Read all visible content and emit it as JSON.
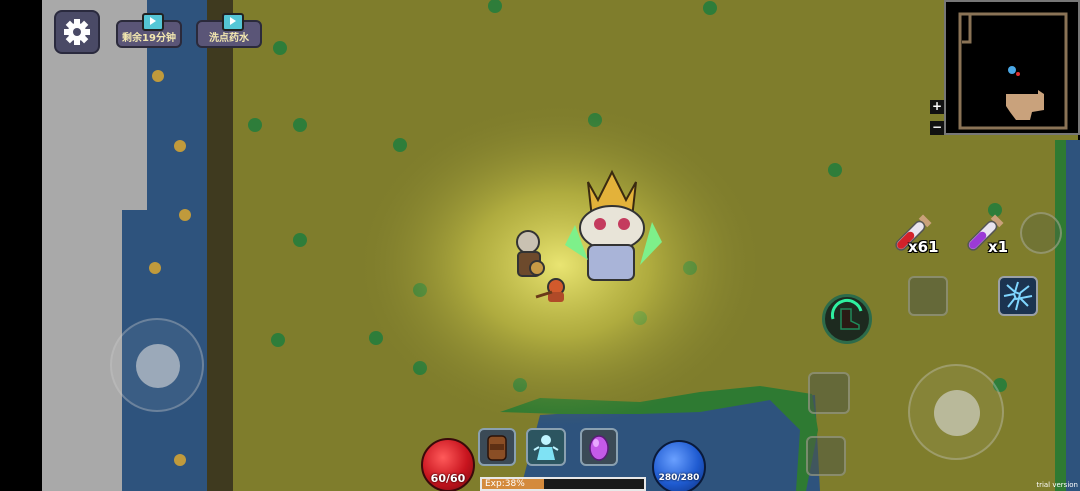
{
  "hud": {
    "settings_icon": "gear-icon",
    "ad_buttons": [
      {
        "label": "剩余19分钟",
        "icon": "tv-icon"
      },
      {
        "label": "洗点药水",
        "icon": "tv-icon"
      }
    ]
  },
  "minimap": {
    "zoom_in": "+",
    "zoom_out": "−"
  },
  "items": {
    "red_potion_count": "x61",
    "purple_potion_count": "x1"
  },
  "bottom_bar": {
    "hp_text": "60/60",
    "mp_text": "280/280",
    "exp_text": "Exp:38%",
    "exp_progress": 0.38,
    "slots": [
      "backpack-icon",
      "character-icon",
      "pet-egg-icon"
    ]
  },
  "watermark": "trial version",
  "colors": {
    "grass": "#7f7d2c",
    "water": "#2f5580",
    "hp": "#c8141e",
    "mp": "#1f5bd1",
    "exp": "#d48a3c"
  }
}
